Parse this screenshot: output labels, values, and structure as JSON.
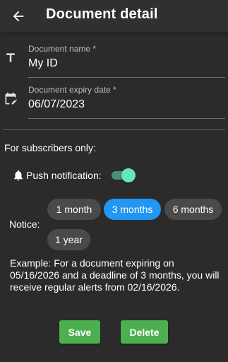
{
  "header": {
    "title": "Document detail",
    "back_icon": "arrow-back-icon"
  },
  "form": {
    "name_label": "Document name *",
    "name_value": "My ID",
    "name_icon": "text-icon",
    "expiry_label": "Document expiry date *",
    "expiry_value": "06/07/2023",
    "expiry_icon": "calendar-edit-icon"
  },
  "subscribers": {
    "section_label": "For subscribers only:",
    "push_label": "Push notification:",
    "push_icon": "bell-icon",
    "push_enabled": true,
    "notice_label": "Notice:",
    "notice_options": [
      "1 month",
      "3 months",
      "6 months",
      "1 year"
    ],
    "notice_selected": "3 months",
    "example": "Example: For a document expiring on 05/16/2026 and a deadline of 3 months, you will receive regular alerts from 02/16/2026."
  },
  "actions": {
    "save_label": "Save",
    "delete_label": "Delete"
  },
  "colors": {
    "background": "#2b2b2b",
    "accent": "#2196f3",
    "button": "#4caf50",
    "toggle": "#64e6bf"
  }
}
